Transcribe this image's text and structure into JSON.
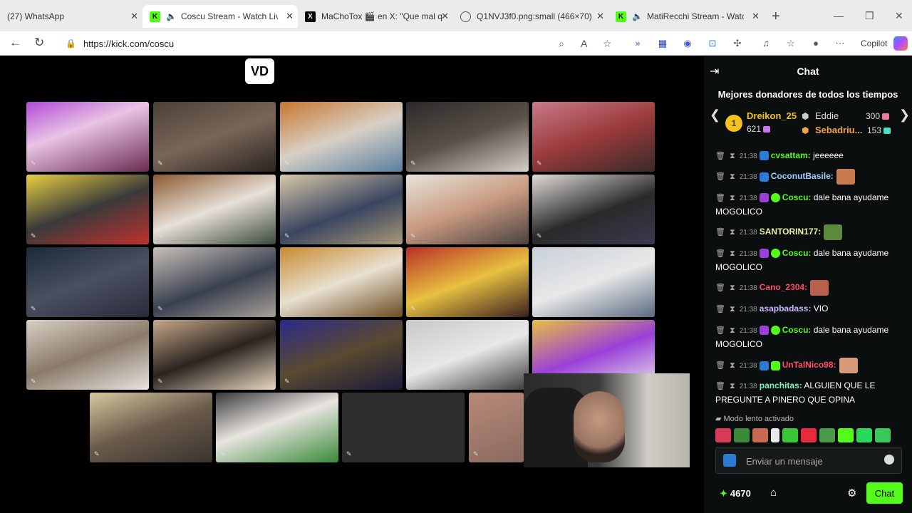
{
  "browser": {
    "tabs": [
      {
        "label": "(27) WhatsApp",
        "icon": "whatsapp-icon"
      },
      {
        "label": "Coscu Stream - Watch Live",
        "icon": "kick-icon",
        "muted": true
      },
      {
        "label": "MaChoTox 🎬 en X: \"Que mal q",
        "icon": "x-icon"
      },
      {
        "label": "Q1NVJ3f0.png:small (466×70)",
        "icon": "globe-icon"
      },
      {
        "label": "MatiRecchi Stream - Watch",
        "icon": "kick-icon",
        "muted": true
      }
    ],
    "url": "https://kick.com/coscu",
    "copilot_label": "Copilot"
  },
  "stream": {
    "overlay_logo": "VD"
  },
  "chat": {
    "title": "Chat",
    "donors_title": "Mejores donadores de todos los tiempos",
    "donors": [
      {
        "rank": "1",
        "name": "Dreikon_25",
        "amount": "621",
        "color": "#f4c21a"
      },
      {
        "name": "Eddie",
        "amount": "300",
        "color": "#d8d8d8"
      },
      {
        "name": "Sebadriu...",
        "amount": "153",
        "color": "#f0a24c"
      }
    ],
    "messages": [
      {
        "time": "21:38",
        "user": "cvsattam:",
        "text": "jeeeeee",
        "color": "#53fc18"
      },
      {
        "time": "21:38",
        "user": "CoconutBasile:",
        "text": "",
        "color": "#9fd0ff"
      },
      {
        "time": "21:38",
        "user": "Coscu:",
        "text": "dale bana ayudame MOGOLICO",
        "color": "#53fc18"
      },
      {
        "time": "21:38",
        "user": "SANTORIN177:",
        "text": "",
        "color": "#e8f0a8"
      },
      {
        "time": "21:38",
        "user": "Coscu:",
        "text": "dale bana ayudame MOGOLICO",
        "color": "#53fc18"
      },
      {
        "time": "21:38",
        "user": "Cano_2304:",
        "text": "",
        "color": "#ff4d6a"
      },
      {
        "time": "21:38",
        "user": "asapbadass:",
        "text": "VIO",
        "color": "#c8b6ff"
      },
      {
        "time": "21:38",
        "user": "Coscu:",
        "text": "dale bana ayudame MOGOLICO",
        "color": "#53fc18"
      },
      {
        "time": "21:38",
        "user": "UnTalNico98:",
        "text": "",
        "color": "#ff4d6a"
      },
      {
        "time": "21:38",
        "user": "panchitas:",
        "text": "ALGUIEN QUE LE PREGUNTE A PINERO QUE OPINA",
        "color": "#7ff0c0"
      }
    ],
    "slow_mode": "Modo lento activado",
    "input_placeholder": "Enviar un mensaje",
    "points": "4670",
    "send_label": "Chat"
  }
}
